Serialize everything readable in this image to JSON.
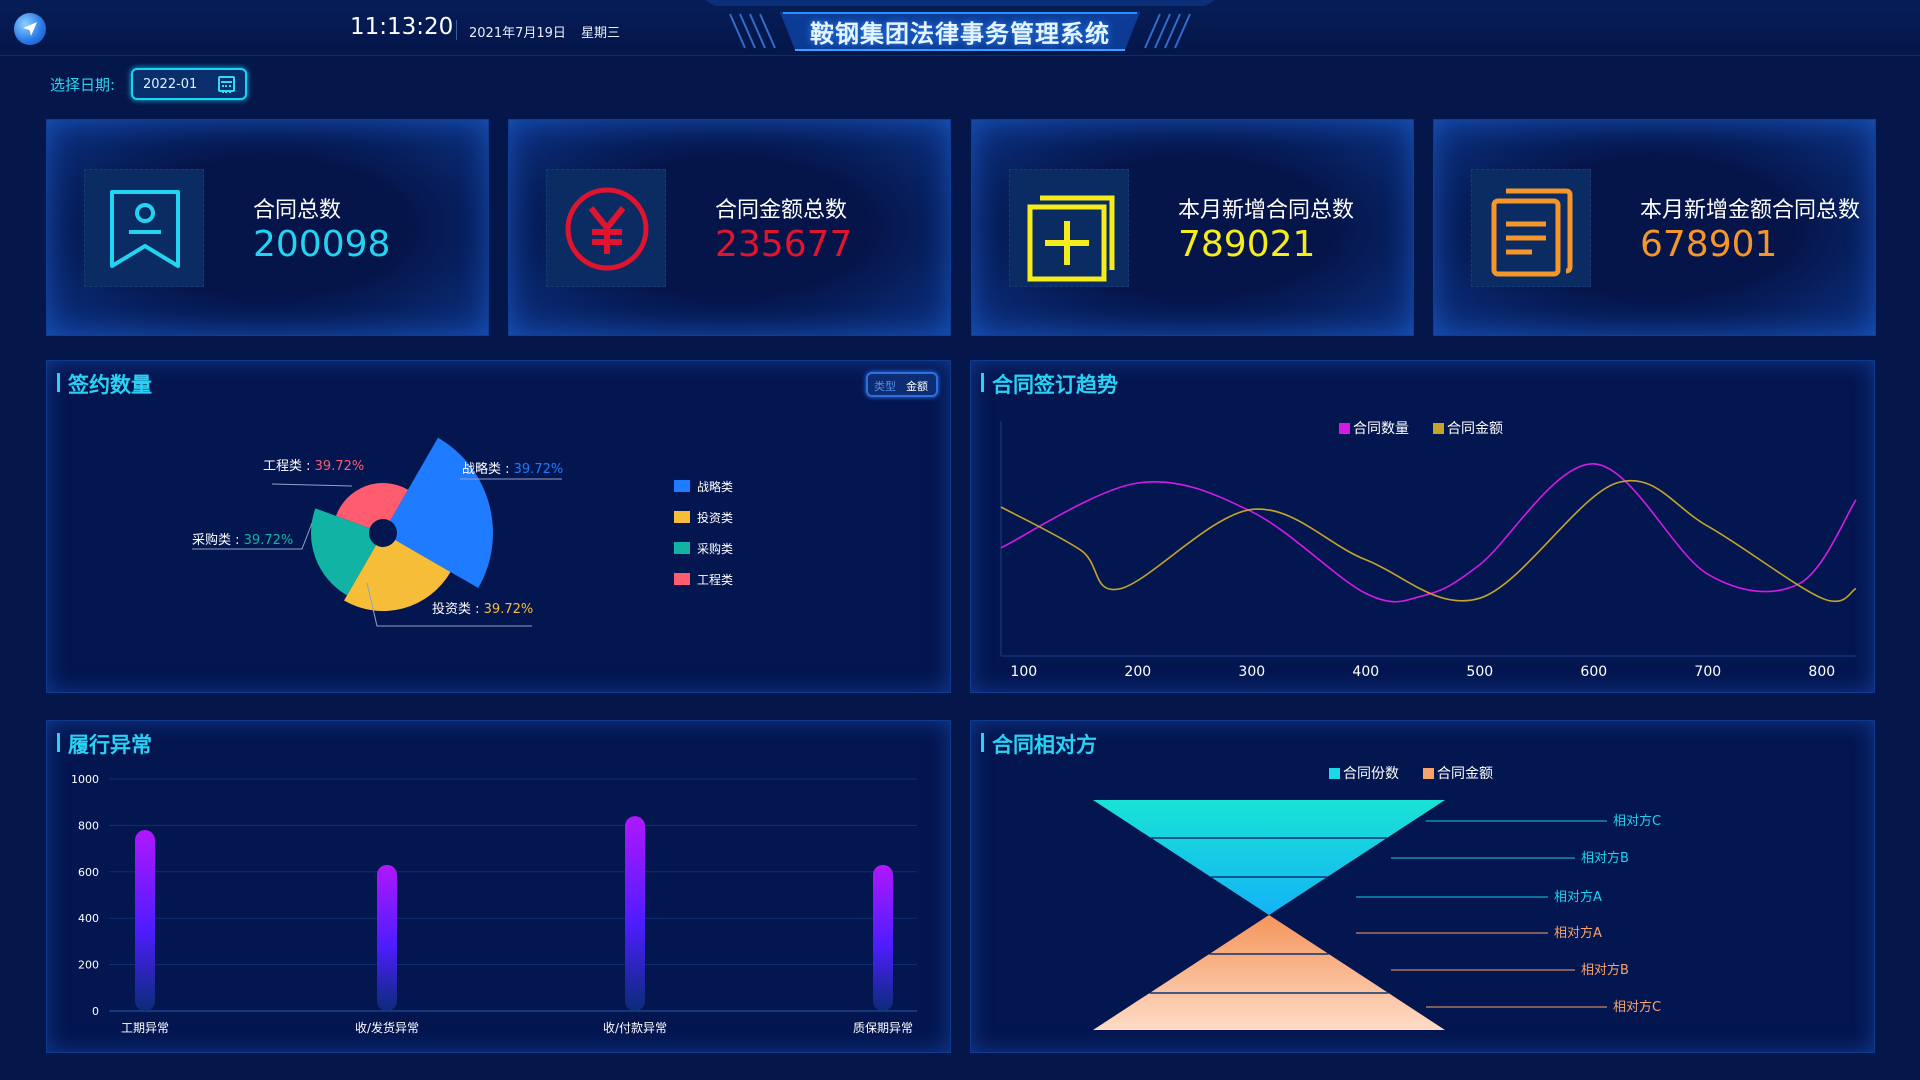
{
  "header": {
    "time": "11:13:20",
    "date": "2021年7月19日",
    "weekday": "星期三",
    "title": "鞍钢集团法律事务管理系统"
  },
  "date_picker": {
    "label": "选择日期:",
    "value": "2022-01"
  },
  "stats": [
    {
      "label": "合同总数",
      "value": "200098",
      "color": "#22d3f2",
      "icon": "bookmark-badge-icon"
    },
    {
      "label": "合同金额总数",
      "value": "235677",
      "color": "#e0142f",
      "icon": "yen-circle-icon"
    },
    {
      "label": "本月新增合同总数",
      "value": "789021",
      "color": "#f6ec1c",
      "icon": "add-document-icon"
    },
    {
      "label": "本月新增金额合同总数",
      "value": "678901",
      "color": "#f4962a",
      "icon": "document-stack-icon"
    }
  ],
  "panels": {
    "signing": {
      "title": "签约数量",
      "toggle": [
        "类型",
        "金额"
      ]
    },
    "trend": {
      "title": "合同签订趋势"
    },
    "anomaly": {
      "title": "履行异常"
    },
    "counterparty": {
      "title": "合同相对方"
    }
  },
  "chart_data": [
    {
      "type": "pie",
      "variant": "rose",
      "slices": [
        {
          "name": "战略类",
          "label": "战略类",
          "percent_label": "39.72%",
          "color": "#1f7bff"
        },
        {
          "name": "投资类",
          "label": "投资类",
          "percent_label": "39.72%",
          "color": "#f6bd38"
        },
        {
          "name": "采购类",
          "label": "采购类",
          "percent_label": "39.72%",
          "color": "#11b3a4"
        },
        {
          "name": "工程类",
          "label": "工程类",
          "percent_label": "39.72%",
          "color": "#ff5c6f"
        }
      ],
      "legend": [
        "战略类",
        "投资类",
        "采购类",
        "工程类"
      ],
      "legend_position": "right"
    },
    {
      "type": "line",
      "smooth": true,
      "x": [
        100,
        200,
        300,
        400,
        500,
        600,
        700,
        800
      ],
      "xlim": [
        80,
        830
      ],
      "ylim": [
        0,
        10
      ],
      "series": [
        {
          "name": "合同数量",
          "color": "#d41be6",
          "points": [
            [
              80,
              4.3
            ],
            [
              200,
              7.0
            ],
            [
              300,
              5.8
            ],
            [
              400,
              2.4
            ],
            [
              450,
              2.3
            ],
            [
              500,
              3.6
            ],
            [
              600,
              7.8
            ],
            [
              700,
              3.2
            ],
            [
              780,
              2.8
            ],
            [
              830,
              6.3
            ]
          ]
        },
        {
          "name": "合同金额",
          "color": "#c4a529",
          "points": [
            [
              80,
              6.0
            ],
            [
              150,
              4.2
            ],
            [
              185,
              2.6
            ],
            [
              300,
              5.9
            ],
            [
              400,
              3.8
            ],
            [
              500,
              2.2
            ],
            [
              620,
              7.0
            ],
            [
              700,
              5.2
            ],
            [
              800,
              2.2
            ],
            [
              830,
              2.6
            ]
          ]
        }
      ],
      "legend_position": "top",
      "grid": false
    },
    {
      "type": "bar",
      "categories": [
        "工期异常",
        "收/发货异常",
        "收/付款异常",
        "质保期异常"
      ],
      "values": [
        780,
        630,
        840,
        630
      ],
      "yticks": [
        0,
        200,
        400,
        600,
        800,
        1000
      ],
      "ylim": [
        0,
        1000
      ],
      "grid": true
    },
    {
      "type": "funnel",
      "legend": [
        "合同份数",
        "合同金额"
      ],
      "series": [
        {
          "name": "合同份数",
          "color": "#19d9e8",
          "levels": [
            "相对方C",
            "相对方B",
            "相对方A"
          ]
        },
        {
          "name": "合同金额",
          "color": "#f7a46a",
          "levels": [
            "相对方A",
            "相对方B",
            "相对方C"
          ]
        }
      ],
      "legend_position": "top"
    }
  ]
}
